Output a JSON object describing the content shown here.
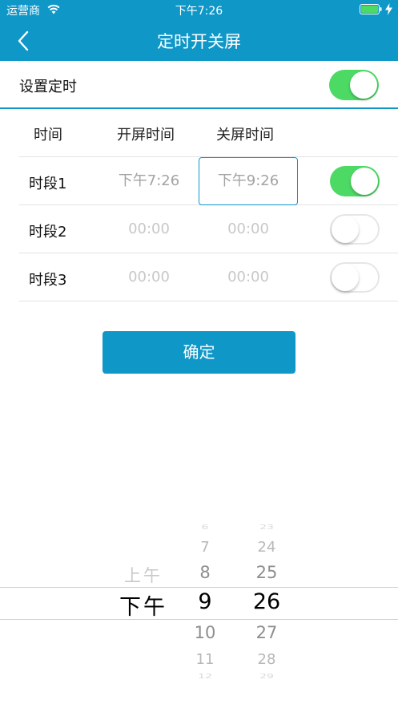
{
  "status_bar": {
    "carrier": "运营商",
    "time": "下午7:26",
    "wifi_icon": "wifi-icon",
    "battery_icon": "battery-full-icon",
    "charging_icon": "charging-bolt-icon"
  },
  "nav": {
    "title": "定时开关屏",
    "back_icon": "chevron-left-icon"
  },
  "setting": {
    "label": "设置定时",
    "enabled": true
  },
  "table": {
    "headers": [
      "时间",
      "开屏时间",
      "关屏时间"
    ],
    "rows": [
      {
        "name": "时段1",
        "on_time": "下午7:26",
        "off_time": "下午9:26",
        "enabled": true
      },
      {
        "name": "时段2",
        "on_time": "00:00",
        "off_time": "00:00",
        "enabled": false
      },
      {
        "name": "时段3",
        "on_time": "00:00",
        "off_time": "00:00",
        "enabled": false
      }
    ]
  },
  "confirm_label": "确定",
  "picker": {
    "period": {
      "above": "上午",
      "selected": "下午"
    },
    "hour": {
      "above": [
        "6",
        "7",
        "8"
      ],
      "selected": "9",
      "below": [
        "10",
        "11",
        "12"
      ]
    },
    "minute": {
      "above": [
        "23",
        "24",
        "25"
      ],
      "selected": "26",
      "below": [
        "27",
        "28",
        "29"
      ]
    }
  },
  "colors": {
    "primary": "#0f97c8",
    "toggle_on": "#4cd964"
  }
}
